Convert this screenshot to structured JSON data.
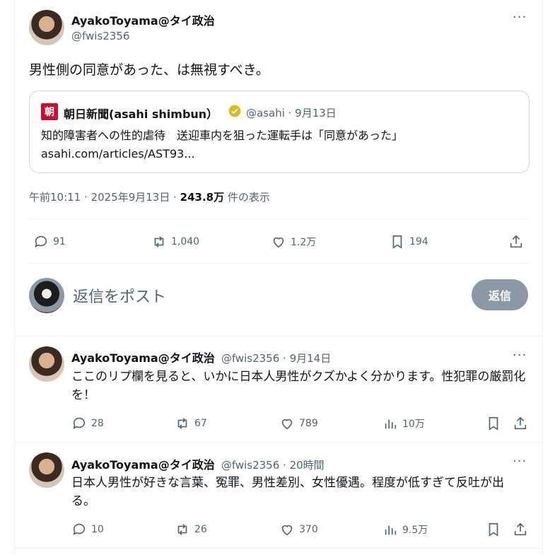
{
  "main_tweet": {
    "display_name": "AyakoToyama@タイ政治",
    "handle": "@fwis2356",
    "more": "···",
    "text": "男性側の同意があった、は無視すべき。",
    "quote": {
      "logo_char": "朝",
      "source_name": "朝日新聞(asahi shimbun）",
      "handle_date": "@asahi · 9月13日",
      "headline": "知的障害者への性的虐待　送迎車内を狙った運転手は「同意があった」",
      "link": "asahi.com/articles/AST93..."
    },
    "timestamp": "午前10:11 · 2025年9月13日 · ",
    "views_count": "243.8万",
    "views_label": " 件の表示",
    "actions": {
      "replies": "91",
      "retweets": "1,040",
      "likes": "1.2万",
      "bookmarks": "194"
    }
  },
  "reply_composer": {
    "placeholder": "返信をポスト",
    "button": "返信"
  },
  "replies": [
    {
      "display_name": "AyakoToyama@タイ政治",
      "meta": "@fwis2356 · 9月14日",
      "more": "···",
      "text": "ここのリプ欄を見ると、いかに日本人男性がクズかよく分かります。性犯罪の厳罰化を！",
      "replies": "28",
      "retweets": "67",
      "likes": "789",
      "views": "10万"
    },
    {
      "display_name": "AyakoToyama@タイ政治",
      "meta": "@fwis2356 · 20時間",
      "more": "···",
      "text": "日本人男性が好きな言葉、冤罪、男性差別、女性優遇。程度が低すぎて反吐が出る。",
      "replies": "10",
      "retweets": "26",
      "likes": "370",
      "views": "9.5万"
    }
  ],
  "colors": {
    "text": "#0f1419",
    "muted": "#536471",
    "border": "#cfd9de",
    "asahi_red": "#c8102e",
    "verified_gold": "#e2b719",
    "reply_button": "#8b98a5"
  }
}
